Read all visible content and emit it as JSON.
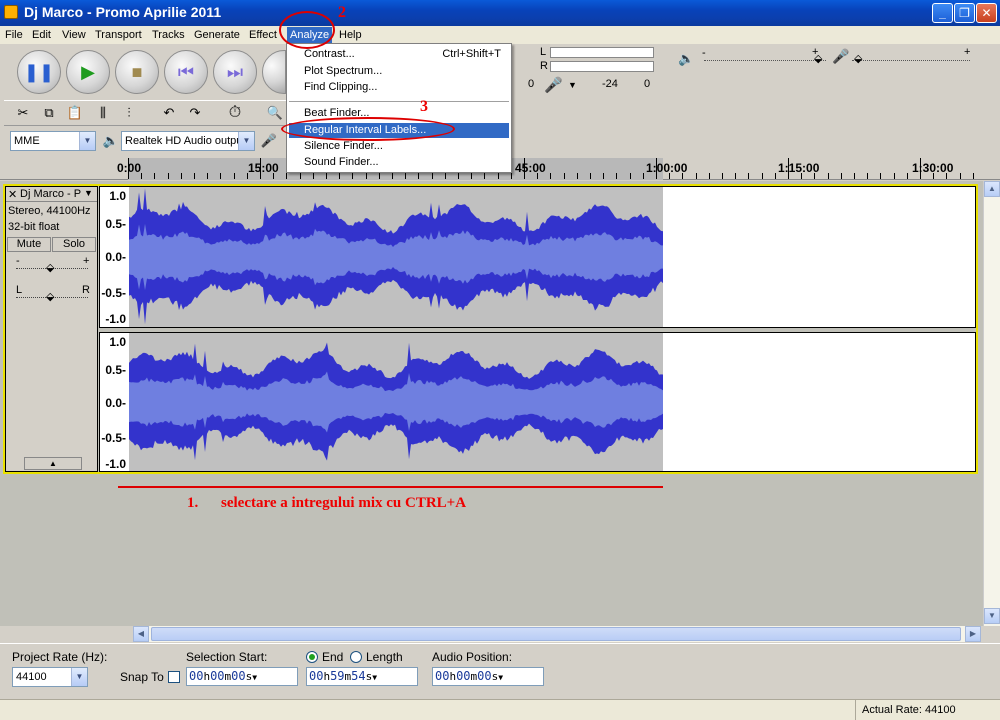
{
  "window": {
    "title": "Dj Marco - Promo Aprilie 2011",
    "minimize": "_",
    "maximize": "❐",
    "close": "✕"
  },
  "menubar": {
    "items": [
      "File",
      "Edit",
      "View",
      "Transport",
      "Tracks",
      "Generate",
      "Effect",
      "Analyze",
      "Help"
    ],
    "active": "Analyze"
  },
  "analyze_menu": {
    "items": [
      {
        "label": "Contrast...",
        "accel": "Ctrl+Shift+T"
      },
      {
        "label": "Plot Spectrum...",
        "accel": ""
      },
      {
        "label": "Find Clipping...",
        "accel": ""
      },
      {
        "label": "Beat Finder...",
        "accel": ""
      },
      {
        "label": "Regular Interval Labels...",
        "accel": "",
        "highlighted": true
      },
      {
        "label": "Silence Finder...",
        "accel": ""
      },
      {
        "label": "Sound Finder...",
        "accel": ""
      }
    ]
  },
  "annotations": {
    "n1": "1.",
    "text1": "selectare a intregului mix cu CTRL+A",
    "n2": "2",
    "n3": "3",
    "color": "#dd0000"
  },
  "meter": {
    "l": "L",
    "r": "R",
    "val0": "0",
    "val_db": "-24",
    "val0b": "0"
  },
  "device": {
    "host": "MME",
    "output": "Realtek HD Audio outpu"
  },
  "volume": {
    "minus": "-",
    "plus": "+"
  },
  "ruler": {
    "labels": [
      "0:00",
      "15:00",
      "45:00",
      "1:00:00",
      "1:15:00",
      "1:30:00"
    ]
  },
  "track": {
    "name": "Dj Marco - P",
    "format": "Stereo, 44100Hz",
    "bitdepth": "32-bit float",
    "mute": "Mute",
    "solo": "Solo",
    "gain_minus": "-",
    "gain_plus": "+",
    "pan_l": "L",
    "pan_r": "R",
    "scale": [
      "1.0",
      "0.5-",
      "0.0-",
      "-0.5-",
      "-1.0"
    ]
  },
  "colors": {
    "wave_outer": "#3333cc",
    "wave_inner": "#6f7fe0",
    "selection": "#c0c0c0",
    "menu_highlight": "#316ac5"
  },
  "bottom": {
    "project_rate_label": "Project Rate (Hz):",
    "project_rate": "44100",
    "snap_to": "Snap To",
    "selection_start_label": "Selection Start:",
    "end_label": "End",
    "length_label": "Length",
    "audio_position_label": "Audio Position:",
    "sel_start": {
      "h": "00",
      "m": "00",
      "s": "00"
    },
    "sel_end": {
      "h": "00",
      "m": "59",
      "s": "54"
    },
    "audio_pos": {
      "h": "00",
      "m": "00",
      "s": "00"
    }
  },
  "status": {
    "actual_rate": "Actual Rate: 44100"
  }
}
